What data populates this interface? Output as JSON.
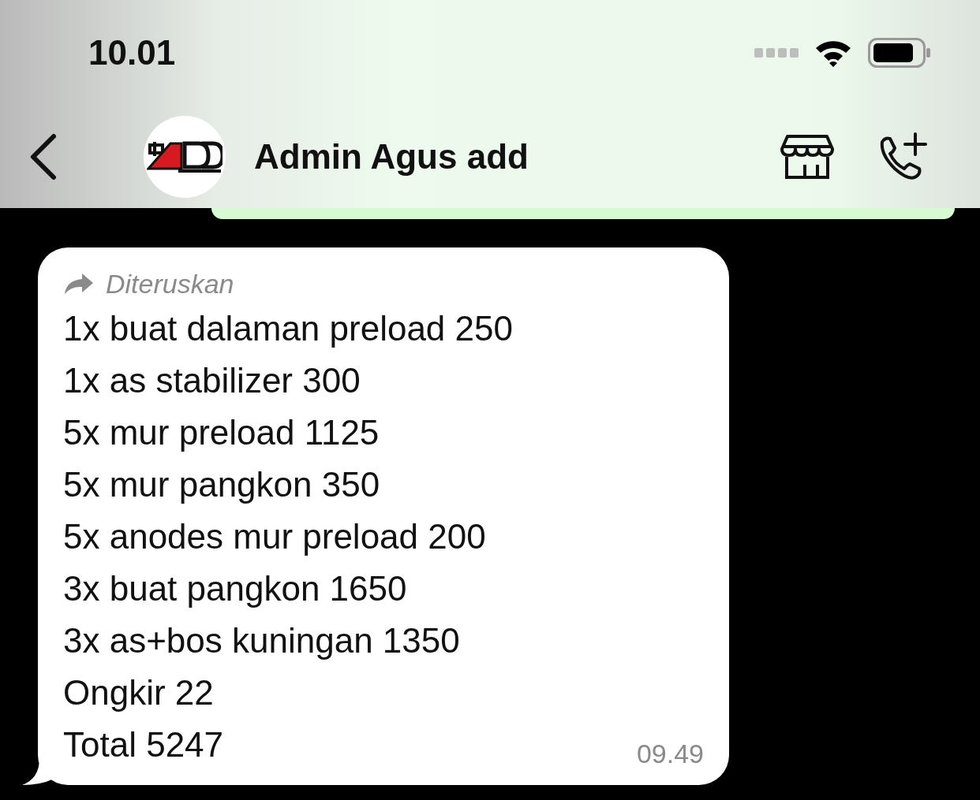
{
  "status_bar": {
    "time": "10.01"
  },
  "header": {
    "contact_name": "Admin Agus add"
  },
  "message": {
    "forwarded": true,
    "forwarded_label": "Diteruskan",
    "lines": [
      "1x buat dalaman preload 250",
      "1x as stabilizer 300",
      "5x mur preload 1125",
      "5x mur pangkon 350",
      "5x anodes mur preload 200",
      "3x buat pangkon 1650",
      "3x as+bos kuningan 1350",
      "Ongkir 22",
      "Total 5247"
    ],
    "time": "09.49"
  }
}
